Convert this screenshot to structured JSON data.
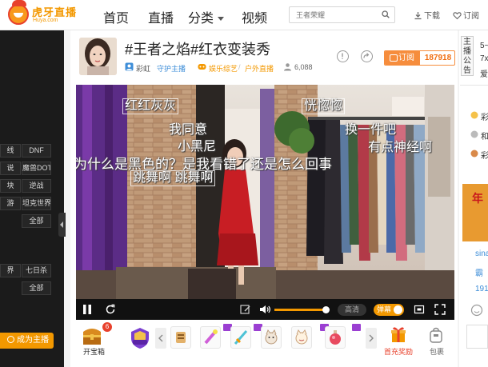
{
  "header": {
    "logo_text": "虎牙直播",
    "logo_sub": "Huya.com",
    "nav": [
      "首页",
      "直播",
      "分类",
      "视频"
    ],
    "search_placeholder": "王者荣耀",
    "download_label": "下载",
    "subscribe_label": "订阅"
  },
  "sidebar": {
    "tags": [
      [
        "线",
        "DNF"
      ],
      [
        "说",
        "魔兽DOTA"
      ],
      [
        "块",
        "逆战"
      ],
      [
        "游",
        "坦克世界"
      ],
      [
        "",
        "全部"
      ],
      [
        "界",
        "七日杀"
      ],
      [
        "",
        "全部"
      ]
    ],
    "become_anchor_label": "成为主播"
  },
  "room": {
    "title": "#王者之焰#红衣变装秀",
    "anchor_name": "彩虹",
    "guard_label": "守护主播",
    "category": "娱乐综艺",
    "subcategory": "户外直播",
    "viewers": "6,088",
    "subscribe_label": "订阅",
    "subscriber_count": "187918"
  },
  "danmu": [
    "红红灰灰",
    "我同意",
    "小黑尼",
    "为什么是黑色的？是我看错了还是怎么回事",
    "跳舞啊 跳舞啊",
    "恍惚惚",
    "换一件吧",
    "有点神经啊"
  ],
  "player": {
    "quality_label": "高清",
    "danmu_label": "弹幕",
    "volume": 0.95
  },
  "gifts": {
    "treasure_label": "开宝箱",
    "treasure_count": "6",
    "charge_label": "首充奖励",
    "bag_label": "包裹"
  },
  "right_panel": {
    "notice_label": "主播公告",
    "line1": "5~",
    "line2": "7x",
    "line3": "爱",
    "item1": "彩",
    "item2": "和",
    "item3": "彩",
    "banner": "年",
    "user1": "sina",
    "user2": "霸",
    "user3": "191"
  },
  "colors": {
    "accent": "#f39800",
    "subscribe": "#f68d3d",
    "sidebar_bg": "#1b1b1b"
  }
}
